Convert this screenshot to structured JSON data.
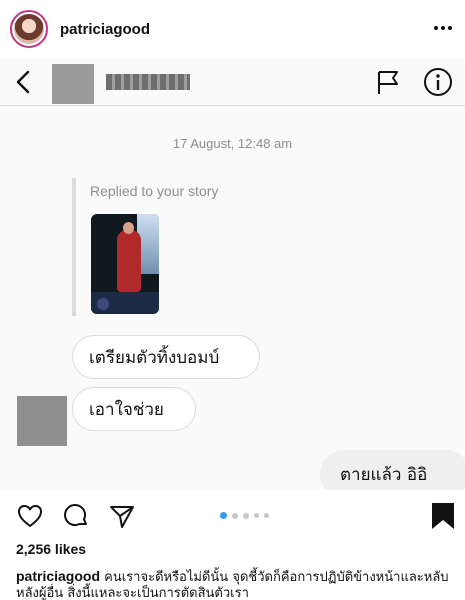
{
  "post": {
    "username": "patriciagood",
    "likes": "2,256 likes",
    "caption_username": "patriciagood",
    "caption_text": "คนเราจะดีหรือไม่ดีนั้น จุดชี้วัดก็คือการปฏิบัติข้างหน้าและหลับหลังผู้อื่น สิ่งนี้แหละจะเป็นการตัดสินตัวเรา",
    "carousel": {
      "count": 5,
      "active_index": 0
    }
  },
  "dm": {
    "timestamp": "17 August, 12:48 am",
    "replied_label": "Replied to your story",
    "messages": [
      {
        "text": "เตรียมตัวทิ้งบอมบ์",
        "direction": "incoming"
      },
      {
        "text": "เอาใจช่วย",
        "direction": "incoming"
      },
      {
        "text": "ตายแล้ว อิอิ",
        "direction": "outgoing"
      }
    ]
  },
  "icons": {
    "more": "more-icon",
    "back": "back-icon",
    "flag": "flag-icon",
    "info": "info-icon",
    "heart": "heart-icon",
    "comment": "comment-icon",
    "share": "share-icon",
    "bookmark": "bookmark-icon"
  },
  "colors": {
    "accent_dot": "#3897f0",
    "bubble_border": "#dbdbdb",
    "outgoing_bubble": "#efefef",
    "muted_text": "#8e8e8e"
  }
}
